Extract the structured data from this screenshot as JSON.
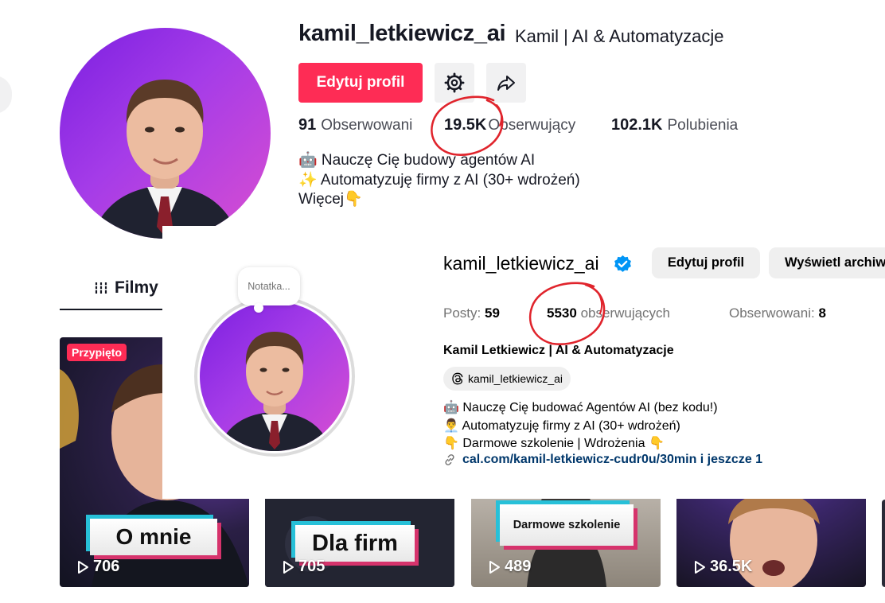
{
  "tiktok": {
    "username": "kamil_letkiewicz_ai",
    "nickname": "Kamil | AI & Automatyzacje",
    "edit_label": "Edytuj profil",
    "stats": [
      {
        "value": "91",
        "label": "Obserwowani"
      },
      {
        "value": "19.5K",
        "label": "Obserwujący"
      },
      {
        "value": "102.1K",
        "label": "Polubienia"
      }
    ],
    "bio": [
      "🤖 Nauczę Cię budowy agentów AI",
      "✨ Automatyzuję firmy z AI (30+ wdrożeń)",
      "Więcej👇"
    ],
    "tab_label": "Filmy",
    "pinned_label": "Przypięto",
    "videos": [
      {
        "caption": "O mnie",
        "plays": "706"
      },
      {
        "caption": "Dla firm",
        "plays": "705"
      },
      {
        "caption": "Darmowe szkolenie",
        "plays": "489"
      },
      {
        "caption": "",
        "plays": "36.5K"
      }
    ],
    "icons": [
      "settings-gear-icon",
      "share-arrow-icon",
      "play-icon",
      "list-icon"
    ],
    "accent_color": "#fe2c55"
  },
  "instagram": {
    "note": "Notatka...",
    "username": "kamil_letkiewicz_ai",
    "edit_label": "Edytuj profil",
    "archive_label": "Wyświetl archiw",
    "stats": {
      "posts_label": "Posty:",
      "posts_value": "59",
      "followers_value": "5530",
      "followers_label": "obserwujących",
      "following_label": "Obserwowani:",
      "following_value": "8"
    },
    "full_name": "Kamil Letkiewicz | AI & Automatyzacje",
    "threads_handle": "kamil_letkiewicz_ai",
    "bio": [
      "🤖 Nauczę Cię budować Agentów AI (bez kodu!)",
      "👨‍💼 Automatyzuję firmy z AI (30+ wdrożeń)",
      "👇 Darmowe szkolenie | Wdrożenia 👇"
    ],
    "link": "cal.com/kamil-letkiewicz-cudr0u/30min i jeszcze 1",
    "icons": [
      "verified-badge-icon",
      "threads-icon",
      "link-icon"
    ],
    "verified_color": "#0095f6"
  }
}
